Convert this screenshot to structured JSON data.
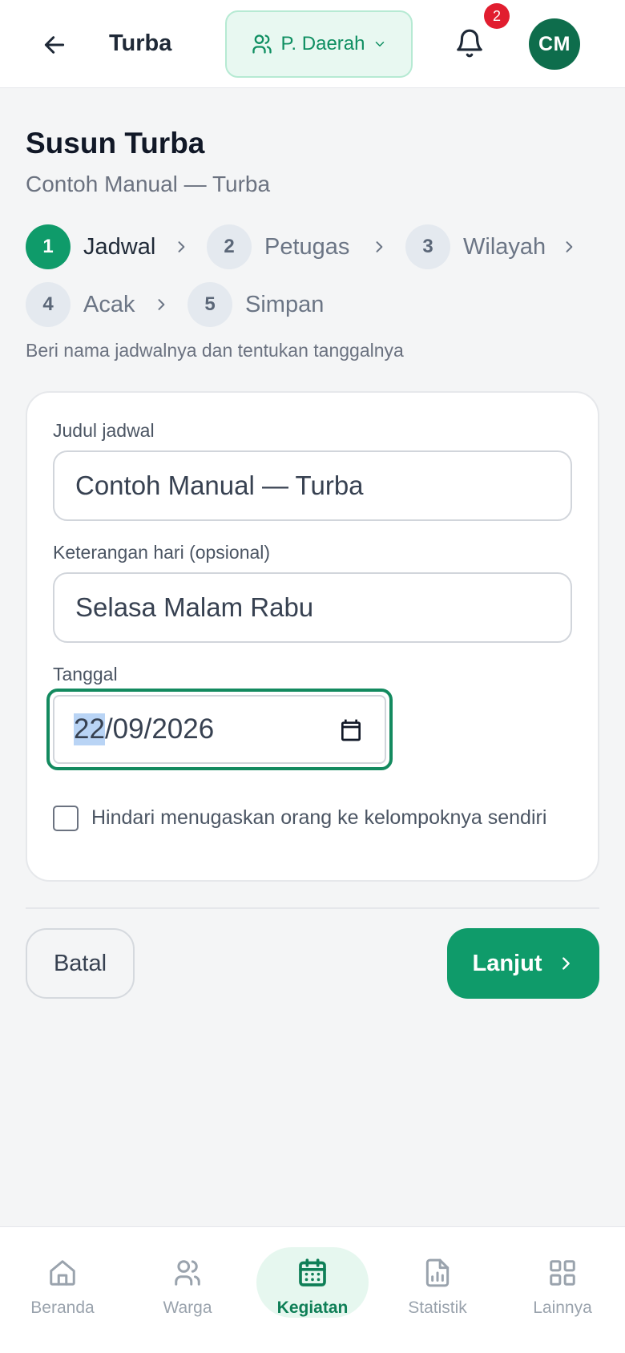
{
  "header": {
    "title": "Turba",
    "org_select": "P. Daerah",
    "notification_count": "2",
    "avatar_initials": "CM"
  },
  "page": {
    "title": "Susun Turba",
    "subtitle": "Contoh Manual — Turba",
    "hint": "Beri nama jadwalnya dan tentukan tanggalnya"
  },
  "steps": [
    {
      "num": "1",
      "label": "Jadwal",
      "active": true
    },
    {
      "num": "2",
      "label": "Petugas"
    },
    {
      "num": "3",
      "label": "Wilayah"
    },
    {
      "num": "4",
      "label": "Acak"
    },
    {
      "num": "5",
      "label": "Simpan"
    }
  ],
  "form": {
    "title_label": "Judul jadwal",
    "title_value": "Contoh Manual — Turba",
    "day_label": "Keterangan hari (opsional)",
    "day_value": "Selasa Malam Rabu",
    "date_label": "Tanggal",
    "date_day": "22",
    "date_rest": "/09/2026",
    "checkbox_label": "Hindari menugaskan orang ke kelompoknya sendiri"
  },
  "actions": {
    "cancel": "Batal",
    "next": "Lanjut"
  },
  "bottom_nav": [
    {
      "label": "Beranda",
      "icon": "home-icon"
    },
    {
      "label": "Warga",
      "icon": "users-icon"
    },
    {
      "label": "Kegiatan",
      "icon": "calendar-icon",
      "active": true
    },
    {
      "label": "Statistik",
      "icon": "chart-file-icon"
    },
    {
      "label": "Lainnya",
      "icon": "grid-icon"
    }
  ],
  "colors": {
    "accent": "#0f9b6a",
    "badge": "#e11d2f",
    "avatar": "#0e6d4c"
  }
}
